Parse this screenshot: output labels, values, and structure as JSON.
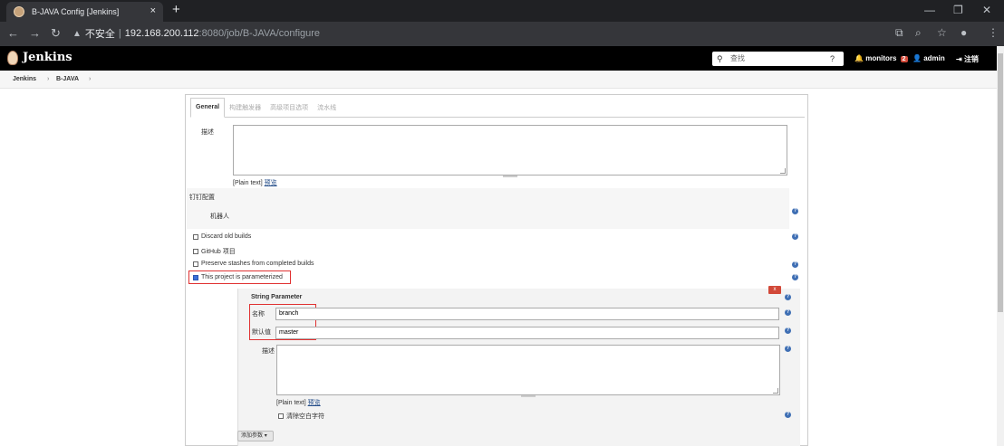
{
  "browser": {
    "tab_title": "B-JAVA Config [Jenkins]",
    "tab_close": "×",
    "new_tab": "+",
    "url_security": "不安全",
    "url_host": "192.168.200.112",
    "url_path": ":8080/job/B-JAVA/configure"
  },
  "jenkins": {
    "title": "Jenkins",
    "search_placeholder": "查找",
    "monitors_label": "monitors",
    "monitors_count": "2",
    "user_label": "admin",
    "logout_label": "注销"
  },
  "breadcrumb": {
    "items": [
      "Jenkins",
      "B-JAVA"
    ]
  },
  "config": {
    "tabs": [
      "General",
      "构建触发器",
      "高级项目选项",
      "流水线"
    ],
    "description_label": "描述",
    "plain_text": "[Plain text]",
    "preview": "预览",
    "dingtalk_section": "钉钉配置",
    "robot_label": "机器人",
    "options": [
      {
        "label": "Discard old builds",
        "checked": false
      },
      {
        "label": "GitHub 项目",
        "checked": false
      },
      {
        "label": "Preserve stashes from completed builds",
        "checked": false
      },
      {
        "label": "This project is parameterized",
        "checked": true
      }
    ],
    "string_parameter": {
      "title": "String Parameter",
      "delete_label": "x",
      "name_label": "名称",
      "name_value": "branch",
      "default_label": "默认值",
      "default_value": "master",
      "description_label": "描述",
      "plain_text": "[Plain text]",
      "preview": "预览",
      "trim_label": "清除空白字符"
    },
    "add_param_label": "添加参数"
  },
  "colors": {
    "accent_red": "#e03131",
    "help_blue": "#3f6fb4",
    "header_black": "#000000"
  }
}
